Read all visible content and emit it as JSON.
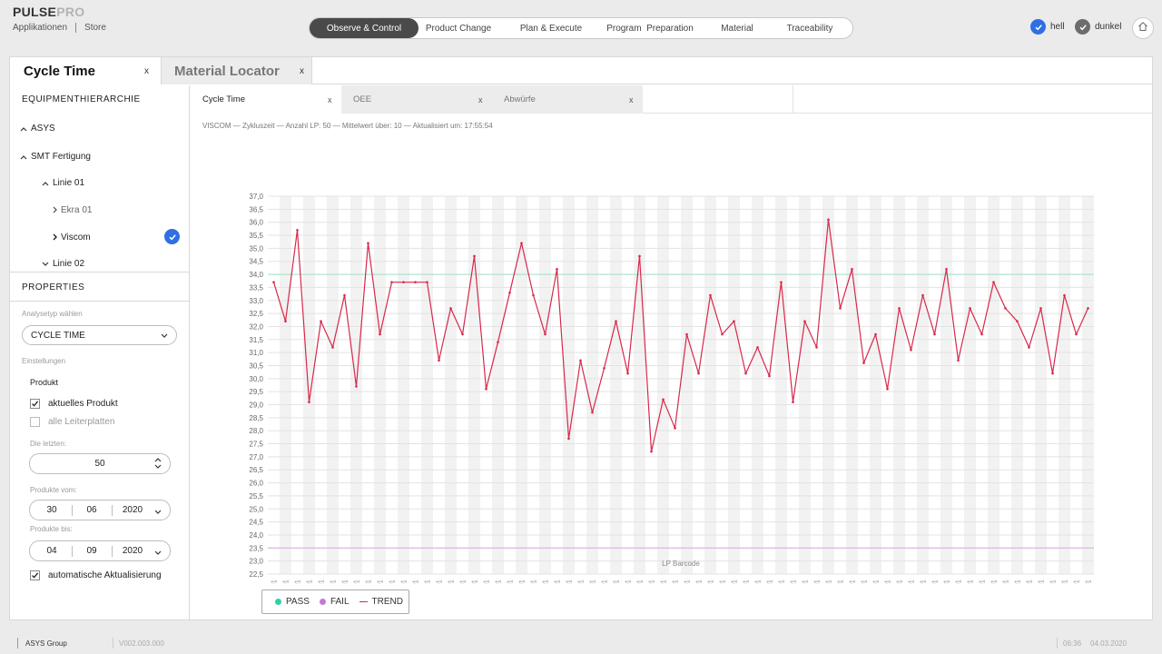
{
  "header": {
    "brand_main": "PULSE",
    "brand_accent": "PRO",
    "nav_links": [
      "Applikationen",
      "Store"
    ],
    "tabs": [
      {
        "label": "Observe & Control",
        "active": true
      },
      {
        "label": "Product Change",
        "active": false
      },
      {
        "label": "Plan & Execute",
        "active": false
      },
      {
        "label": "Program  Preparation",
        "active": false
      },
      {
        "label": "Material",
        "active": false
      },
      {
        "label": "Traceability",
        "active": false
      }
    ],
    "theme_light": "hell",
    "theme_dark": "dunkel",
    "home_icon": "home-icon"
  },
  "main_tabs": [
    {
      "label": "Cycle Time",
      "close": "x",
      "active": true
    },
    {
      "label": "Material Locator",
      "close": "x",
      "active": false
    }
  ],
  "sidebar": {
    "hierarchy_title": "EQUIPMENTHIERARCHIE",
    "tree": [
      {
        "label": "ASYS",
        "caret": "^"
      },
      {
        "label": "SMT Fertigung",
        "caret": "^"
      },
      {
        "label": "Linie 01",
        "caret": "^"
      },
      {
        "label": "Ekra 01",
        "caret": ">"
      },
      {
        "label": "Viscom",
        "caret": ">",
        "selected": true
      },
      {
        "label": "Linie 02",
        "caret": "v"
      }
    ],
    "properties_title": "PROPERTIES",
    "analysis_label": "Analysetyp wählen",
    "analysis_value": "CYCLE TIME",
    "settings_label": "Einstellungen",
    "product_label": "Produkt",
    "current_product": "aktuelles Produkt",
    "current_product_checked": true,
    "all_boards": "alle Leiterplatten",
    "all_boards_checked": false,
    "last_label": "Die letzten:",
    "last_value": "50",
    "from_label": "Produkte vom:",
    "from_date": {
      "day": "30",
      "month": "06",
      "year": "2020"
    },
    "to_label": "Produkte bis:",
    "to_date": {
      "day": "04",
      "month": "09",
      "year": "2020"
    },
    "auto_update": "automatische Aktualisierung",
    "auto_update_checked": true
  },
  "chart_tabs": [
    {
      "label": "Cycle Time",
      "close": "x",
      "active": true
    },
    {
      "label": "OEE",
      "close": "x",
      "active": false
    },
    {
      "label": "Abwürfe",
      "close": "x",
      "active": false
    }
  ],
  "chart_subtitle": "VISCOM — Zykluszeit — Anzahl LP: 50 — Mittelwert über: 10 — Aktualisiert um: 17:55:54",
  "legend": {
    "pass": "PASS",
    "fail": "FAIL",
    "trend": "TREND"
  },
  "colors": {
    "accent_blue": "#2f6fe4",
    "trend": "#d9274a",
    "pass": "#2fd1a6",
    "fail": "#c27ad6",
    "upper_limit_line": "#a8e3cf",
    "lower_limit_line": "#d9b3df"
  },
  "chart_data": {
    "type": "line",
    "xlabel": "LP Barcode",
    "ylabel": "",
    "ylim": [
      22.5,
      37.0
    ],
    "ytick_step": 0.5,
    "x_tick_label": "00000001",
    "grid": true,
    "upper_limit": 34.0,
    "lower_limit": 23.5,
    "legend_position": "bottom-left",
    "series": [
      {
        "name": "TREND",
        "values": [
          33.7,
          32.2,
          35.7,
          29.1,
          32.2,
          31.2,
          33.2,
          29.7,
          35.2,
          31.7,
          33.7,
          33.7,
          33.7,
          33.7,
          30.7,
          32.7,
          31.7,
          34.7,
          29.6,
          31.4,
          33.3,
          35.2,
          33.2,
          31.7,
          34.2,
          27.7,
          30.7,
          28.7,
          30.4,
          32.2,
          30.2,
          34.7,
          27.2,
          29.2,
          28.1,
          31.7,
          30.2,
          33.2,
          31.7,
          32.2,
          30.2,
          31.2,
          30.1,
          33.7,
          29.1,
          32.2,
          31.2,
          36.1,
          32.7,
          34.2,
          30.6,
          31.7,
          29.6,
          32.7,
          31.1,
          33.2,
          31.7,
          34.2,
          30.7,
          32.7,
          31.7,
          33.7,
          32.7,
          32.2,
          31.2,
          32.7,
          30.2,
          33.2,
          31.7,
          32.7
        ]
      }
    ]
  },
  "footer": {
    "company": "ASYS Group",
    "version": "V002.003.000",
    "time": "06:36",
    "date": "04.03.2020"
  }
}
